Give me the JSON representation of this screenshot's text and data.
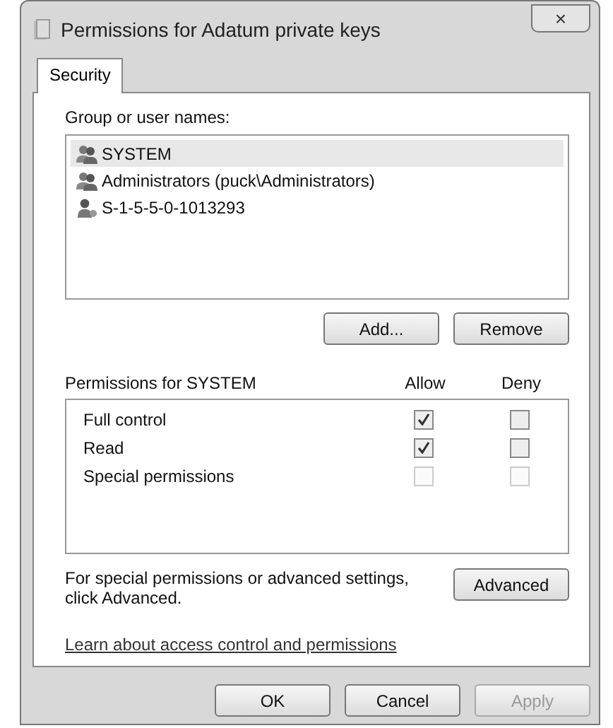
{
  "window": {
    "title": "Permissions for Adatum private keys",
    "close": "×"
  },
  "tabs": [
    {
      "label": "Security",
      "selected": true
    }
  ],
  "users": {
    "label": "Group or user names:",
    "items": [
      {
        "name": "SYSTEM",
        "kind": "group",
        "selected": true
      },
      {
        "name": "Administrators (puck\\Administrators)",
        "kind": "group",
        "selected": false
      },
      {
        "name": "S-1-5-5-0-1013293",
        "kind": "user",
        "selected": false
      }
    ]
  },
  "user_buttons": [
    {
      "label": "Add...",
      "disabled": false
    },
    {
      "label": "Remove",
      "disabled": false
    }
  ],
  "permissions": {
    "label": "Permissions for SYSTEM",
    "columns": [
      "Allow",
      "Deny"
    ],
    "rows": [
      {
        "name": "Full control",
        "allow": {
          "checked": true,
          "disabled": false
        },
        "deny": {
          "checked": false,
          "disabled": false
        }
      },
      {
        "name": "Read",
        "allow": {
          "checked": true,
          "disabled": false
        },
        "deny": {
          "checked": false,
          "disabled": false
        }
      },
      {
        "name": "Special permissions",
        "allow": {
          "checked": false,
          "disabled": true
        },
        "deny": {
          "checked": false,
          "disabled": true
        }
      }
    ]
  },
  "advanced": {
    "text": "For special permissions or advanced settings, click Advanced.",
    "button": "Advanced"
  },
  "link": "Learn about access control and permissions",
  "buttons": [
    {
      "label": "OK",
      "disabled": false
    },
    {
      "label": "Cancel",
      "disabled": false
    },
    {
      "label": "Apply",
      "disabled": true
    }
  ]
}
